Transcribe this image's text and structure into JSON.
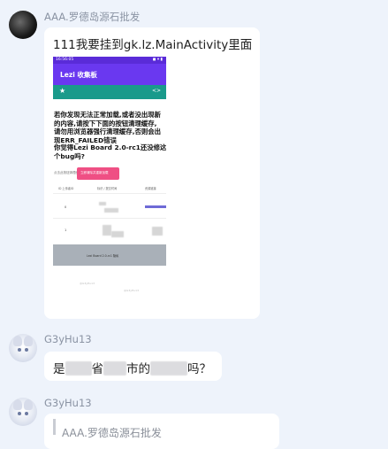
{
  "messages": [
    {
      "sender": "AAA.罗德岛源石批发",
      "text": "111我要挂到gk.lz.MainActivity里面",
      "screenshot": {
        "status_time": "16:56:05",
        "status_icons": "◼ ▾ ▮",
        "app_title": "Lezi 收集板",
        "star": "★",
        "code_icon": "<>",
        "warning_lines": [
          "若你发现无法正常加载,或者没出现新",
          "的内容,请按下下面的按钮清理缓存,",
          "请勿用浏览器强行清理缓存,否则会出",
          "现ERR_FAILED错误"
        ],
        "question_lines": [
          "你觉得Lezi Board 2.0-rc1还没修这",
          "个bug吗?"
        ],
        "small_label": "点击此按钮清理缓存",
        "button_label": "立即清除并重新加载",
        "table_headers": [
          "ID 上传者ID",
          "标识 / 提交时间",
          "资源链接"
        ],
        "rows": [
          "0",
          "1"
        ],
        "footer": "Lezi Board 2.0-rc1 隐私",
        "watermarks": [
          "@G3yHu13",
          "@G3yHu13"
        ]
      }
    },
    {
      "sender": "G3yHu13",
      "text_parts": [
        "是",
        "省",
        "市的",
        "吗？"
      ]
    },
    {
      "sender": "G3yHu13",
      "quote": "AAA.罗德岛源石批发"
    }
  ]
}
